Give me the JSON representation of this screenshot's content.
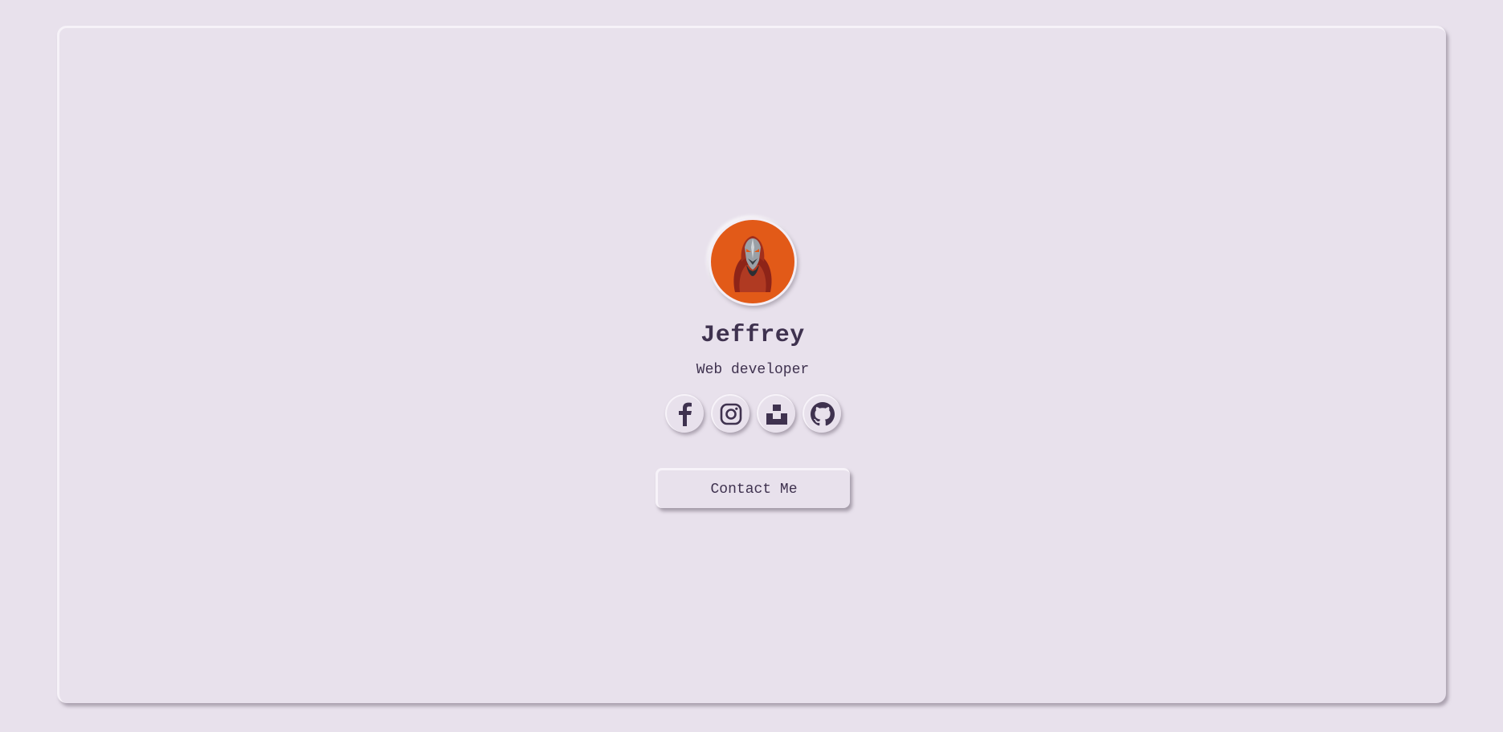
{
  "profile": {
    "name": "Jeffrey",
    "role": "Web developer"
  },
  "socials": [
    {
      "icon": "facebook-icon"
    },
    {
      "icon": "instagram-icon"
    },
    {
      "icon": "unsplash-icon"
    },
    {
      "icon": "github-icon"
    }
  ],
  "contact": {
    "label": "Contact Me"
  },
  "colors": {
    "background": "#e8e1ec",
    "text": "#3f324f",
    "avatar_bg": "#e25a18"
  }
}
